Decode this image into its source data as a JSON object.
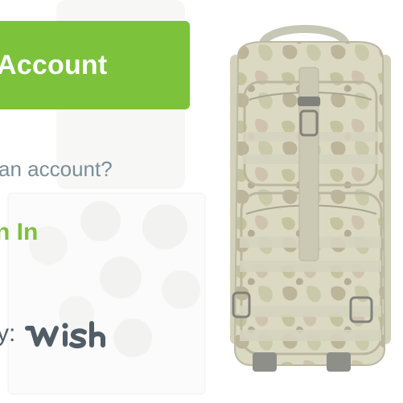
{
  "create_account": {
    "label": "Account"
  },
  "signin_prompt": {
    "question": "an account?",
    "link": "n In"
  },
  "footer": {
    "by_label": "y:",
    "brand_logo": "wish"
  },
  "product_image": {
    "description": "camouflage tactical backpack"
  },
  "colors": {
    "accent": "#7cc23a",
    "muted_text": "#7a8e9c",
    "dark_text": "#515d66",
    "camo_tan": "#c9c4a3",
    "camo_green": "#a9b07a"
  }
}
